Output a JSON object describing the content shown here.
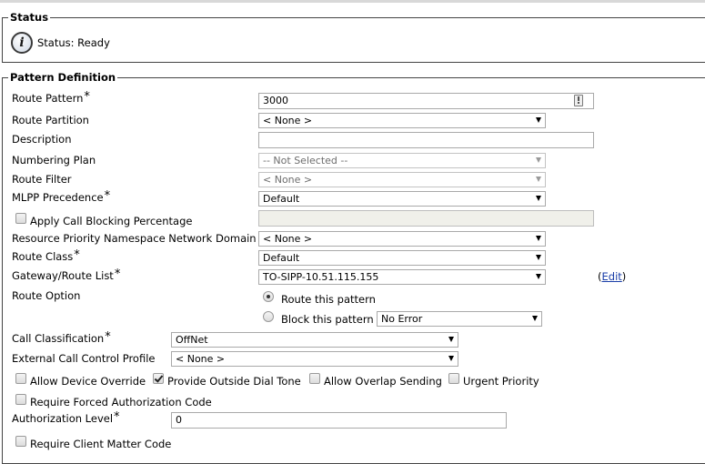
{
  "status": {
    "legend": "Status",
    "text": "Status: Ready",
    "icon": "info-icon"
  },
  "pattern": {
    "legend": "Pattern Definition",
    "route_pattern": {
      "label": "Route Pattern",
      "value": "3000"
    },
    "route_partition": {
      "label": "Route Partition",
      "value": "< None >"
    },
    "description": {
      "label": "Description",
      "value": ""
    },
    "numbering_plan": {
      "label": "Numbering Plan",
      "value": "-- Not Selected --"
    },
    "route_filter": {
      "label": "Route Filter",
      "value": "< None >"
    },
    "mlpp_precedence": {
      "label": "MLPP Precedence",
      "value": "Default"
    },
    "apply_call_blocking": {
      "label": "Apply Call Blocking Percentage",
      "checked": false,
      "value": ""
    },
    "rp_namespace": {
      "label": "Resource Priority Namespace Network Domain",
      "value": "< None >"
    },
    "route_class": {
      "label": "Route Class",
      "value": "Default"
    },
    "gateway_route_list": {
      "label": "Gateway/Route List",
      "value": "TO-SIPP-10.51.115.155",
      "edit_open": "(",
      "edit_label": "Edit",
      "edit_close": ")"
    },
    "route_option": {
      "label": "Route Option",
      "route_this": "Route this pattern",
      "block_this": "Block this pattern",
      "block_reason": "No Error",
      "selected": "route"
    },
    "call_classification": {
      "label": "Call Classification",
      "value": "OffNet"
    },
    "ext_call_control": {
      "label": "External Call Control Profile",
      "value": "< None >"
    },
    "allow_device_override": {
      "label": "Allow Device Override",
      "checked": false
    },
    "provide_outside_dial_tone": {
      "label": "Provide Outside Dial Tone",
      "checked": true
    },
    "allow_overlap_sending": {
      "label": "Allow Overlap Sending",
      "checked": false
    },
    "urgent_priority": {
      "label": "Urgent Priority",
      "checked": false
    },
    "require_fac": {
      "label": "Require Forced Authorization Code",
      "checked": false
    },
    "authorization_level": {
      "label": "Authorization Level",
      "value": "0"
    },
    "require_cmc": {
      "label": "Require Client Matter Code",
      "checked": false
    },
    "required_marker": "*"
  }
}
